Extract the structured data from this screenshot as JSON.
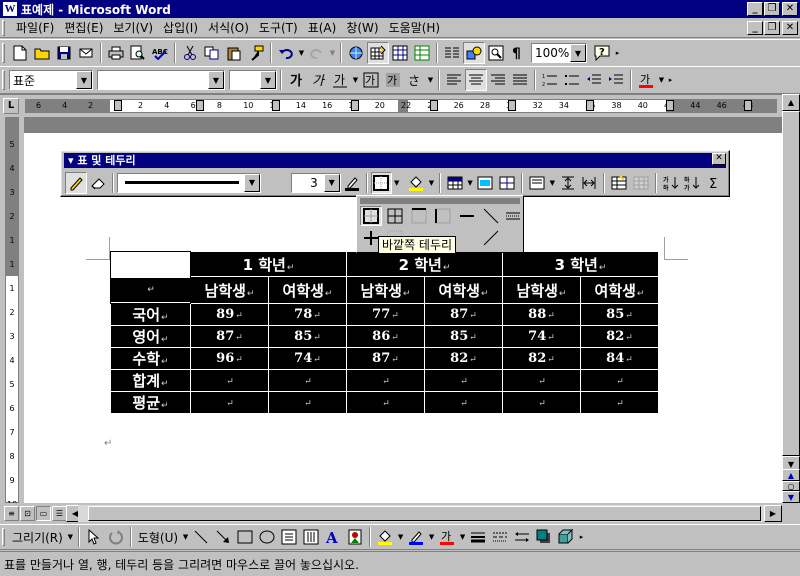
{
  "window": {
    "title": "표예제 - Microsoft Word",
    "app_icon": "W",
    "controls": [
      "_",
      "❐",
      "✕"
    ]
  },
  "menu": {
    "items": [
      "파일(F)",
      "편집(E)",
      "보기(V)",
      "삽입(I)",
      "서식(O)",
      "도구(T)",
      "표(A)",
      "창(W)",
      "도움말(H)"
    ],
    "mdi_controls": [
      "_",
      "❐",
      "✕"
    ]
  },
  "standard_toolbar": {
    "zoom": "100%"
  },
  "formatting_toolbar": {
    "style": "표준",
    "font": "",
    "size": ""
  },
  "ruler": {
    "corner": "L",
    "numbers": [
      "6",
      "4",
      "2",
      "2",
      "4",
      "6",
      "8",
      "10",
      "12",
      "14",
      "16",
      "18",
      "20",
      "22",
      "24",
      "26",
      "28",
      "30",
      "32",
      "34",
      "36",
      "38",
      "40",
      "42",
      "44",
      "46",
      "48"
    ],
    "vertical_numbers": [
      "5",
      "4",
      "3",
      "2",
      "1",
      "1",
      "1",
      "2",
      "3",
      "4",
      "5",
      "6",
      "7",
      "8",
      "9",
      "10"
    ]
  },
  "tables_borders": {
    "title": "표 및 테두리",
    "line_weight": "3",
    "tooltip": "바깥쪽 테두리"
  },
  "table": {
    "years": [
      "1 학년",
      "2 학년",
      "3 학년"
    ],
    "genders": [
      "남학생",
      "여학생",
      "남학생",
      "여학생",
      "남학생",
      "여학생"
    ],
    "rows": [
      {
        "label": "국어",
        "values": [
          "89",
          "78",
          "77",
          "87",
          "88",
          "85"
        ]
      },
      {
        "label": "영어",
        "values": [
          "87",
          "85",
          "86",
          "85",
          "74",
          "82"
        ]
      },
      {
        "label": "수학",
        "values": [
          "96",
          "74",
          "87",
          "82",
          "82",
          "84"
        ]
      },
      {
        "label": "합계",
        "values": [
          "",
          "",
          "",
          "",
          "",
          ""
        ]
      },
      {
        "label": "평균",
        "values": [
          "",
          "",
          "",
          "",
          "",
          ""
        ]
      }
    ],
    "para_mark": "↵"
  },
  "drawing_toolbar": {
    "draw_label": "그리기(R)",
    "autoshapes_label": "도형(U)"
  },
  "status": {
    "text": "표를 만들거나 열, 행, 테두리 등을 그리려면 마우스로 끌어 놓으십시오."
  },
  "colors": {
    "titlebar": "#000080",
    "chrome": "#c0c0c0",
    "table_fill": "#000000",
    "font_color_underline": "#ff0000",
    "highlight_underline": "#ffff00"
  }
}
